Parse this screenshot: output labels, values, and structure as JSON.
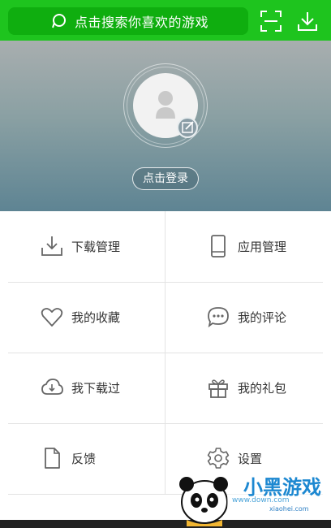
{
  "topbar": {
    "search_placeholder": "点击搜索你喜欢的游戏",
    "icons": {
      "search": "search-icon",
      "scan": "scan-icon",
      "download": "download-icon"
    },
    "color": "#1ec41e"
  },
  "header": {
    "login_label": "点击登录"
  },
  "menu": {
    "download_manage": "下载管理",
    "app_manage": "应用管理",
    "favorites": "我的收藏",
    "comments": "我的评论",
    "downloaded": "我下载过",
    "gifts": "我的礼包",
    "feedback": "反馈",
    "settings": "设置"
  },
  "watermark": {
    "brand": "小黑游戏",
    "url": "www.down.com",
    "sub": "xiaohei.com"
  }
}
